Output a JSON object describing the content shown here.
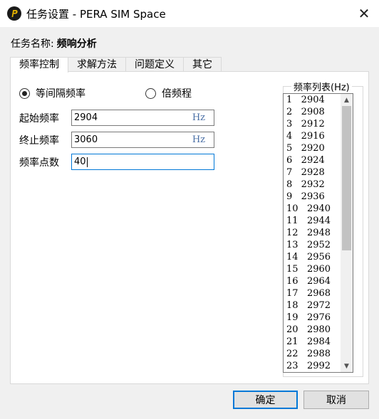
{
  "window": {
    "title": "任务设置 - PERA SIM Space",
    "close_glyph": "✕"
  },
  "task": {
    "label": "任务名称:",
    "name": "频响分析"
  },
  "tabs": [
    {
      "label": "频率控制",
      "active": true
    },
    {
      "label": "求解方法",
      "active": false
    },
    {
      "label": "问题定义",
      "active": false
    },
    {
      "label": "其它",
      "active": false
    }
  ],
  "mode": {
    "equal_interval": {
      "label": "等间隔频率",
      "checked": true
    },
    "octave": {
      "label": "倍频程",
      "checked": false
    }
  },
  "fields": {
    "start_freq": {
      "label": "起始频率",
      "value": "2904",
      "unit": "Hz"
    },
    "end_freq": {
      "label": "终止频率",
      "value": "3060",
      "unit": "Hz"
    },
    "points": {
      "label": "频率点数",
      "value": "40"
    }
  },
  "freq_list": {
    "title": "频率列表(Hz)",
    "items": [
      "1   2904",
      "2   2908",
      "3   2912",
      "4   2916",
      "5   2920",
      "6   2924",
      "7   2928",
      "8   2932",
      "9   2936",
      "10   2940",
      "11   2944",
      "12   2948",
      "13   2952",
      "14   2956",
      "15   2960",
      "16   2964",
      "17   2968",
      "18   2972",
      "19   2976",
      "20   2980",
      "21   2984",
      "22   2988",
      "23   2992"
    ]
  },
  "buttons": {
    "ok": "确定",
    "cancel": "取消"
  },
  "icons": {
    "app_logo": "pera-logo-icon",
    "close": "close-icon",
    "scroll_up": "chevron-up-icon",
    "scroll_down": "chevron-down-icon"
  },
  "colors": {
    "accent": "#0078d7",
    "unit_text": "#4a6fa5",
    "logo_gold": "#e8b400"
  }
}
